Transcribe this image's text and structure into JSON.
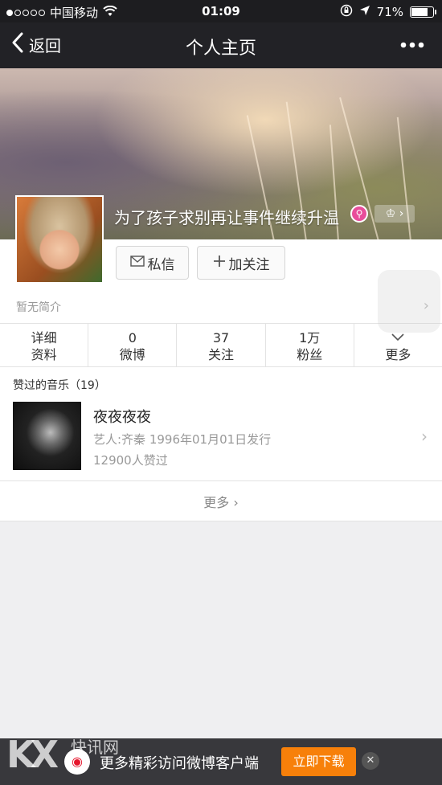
{
  "status_bar": {
    "carrier": "中国移动",
    "time": "01:09",
    "battery": "71%",
    "battery_level": 0.71,
    "icons": [
      "signal-dots-icon",
      "wifi-icon",
      "orientation-lock-icon",
      "location-icon",
      "battery-icon"
    ]
  },
  "nav": {
    "back_label": "返回",
    "title": "个人主页",
    "more_icon": "more-dots-icon"
  },
  "profile": {
    "name": "为了孩子求别再让事件继续升温",
    "badge_crown": "♔",
    "message_label": "私信",
    "follow_label": "加关注",
    "intro": "暂无简介"
  },
  "stats": [
    {
      "line1": "详细",
      "line2": "资料"
    },
    {
      "line1": "0",
      "line2": "微博"
    },
    {
      "line1": "37",
      "line2": "关注"
    },
    {
      "line1": "1万",
      "line2": "粉丝"
    },
    {
      "line1": "",
      "line2": "更多"
    }
  ],
  "music": {
    "header": "赞过的音乐（19）",
    "track": {
      "title": "夜夜夜夜",
      "artist_line": "艺人:齐秦 1996年01月01日发行",
      "likes": "12900人赞过"
    },
    "more_label": "更多"
  },
  "banner": {
    "text": "更多精彩访问微博客户端",
    "button": "立即下载",
    "close": "✕"
  },
  "watermark": {
    "logo": "KX",
    "text": "快讯网"
  },
  "colors": {
    "nav_bg": "#222226",
    "accent_orange": "#f7800a",
    "badge_pink": "#e84d9a"
  }
}
